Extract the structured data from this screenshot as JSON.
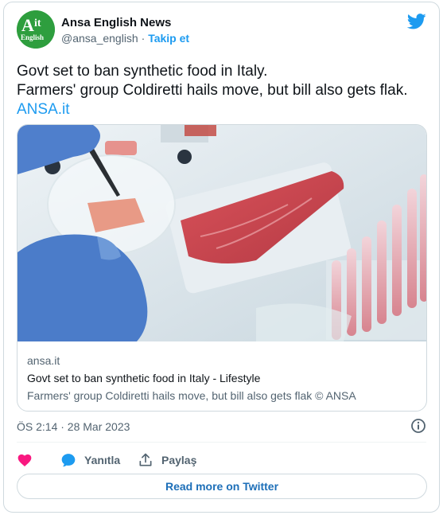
{
  "author": {
    "name": "Ansa English News",
    "handle": "@ansa_english",
    "separator": "·",
    "follow_label": "Takip et",
    "avatar_text_top": "A it",
    "avatar_text_bottom": "English"
  },
  "tweet": {
    "line1": "Govt set to ban synthetic food in Italy.",
    "line2": "Farmers' group Coldiretti hails move, but bill also gets flak.",
    "link": "ANSA.it"
  },
  "link_card": {
    "domain": "ansa.it",
    "title": "Govt set to ban synthetic food in Italy - Lifestyle",
    "description": "Farmers' group Coldiretti hails move, but bill also gets flak © ANSA"
  },
  "timestamp": "ÖS 2:14 · 28 Mar 2023",
  "actions": {
    "reply_label": "Yanıtla",
    "share_label": "Paylaş"
  },
  "read_more_label": "Read more on Twitter",
  "icons": [
    "twitter-bird-icon",
    "info-icon",
    "heart-icon",
    "reply-bubble-icon",
    "share-icon"
  ],
  "colors": {
    "brand_blue": "#1d9bf0",
    "heart": "#f91880",
    "avatar_green": "#2e9e3e"
  }
}
